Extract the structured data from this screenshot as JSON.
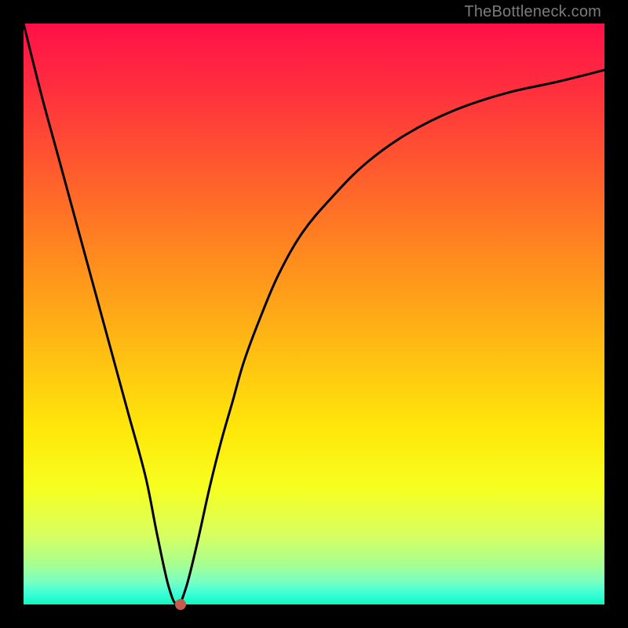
{
  "watermark": "TheBottleneck.com",
  "chart_data": {
    "type": "line",
    "title": "",
    "xlabel": "",
    "ylabel": "",
    "xlim": [
      0,
      100
    ],
    "ylim": [
      0,
      100
    ],
    "background_gradient": {
      "top": "#ff1048",
      "bottom": "#10f7c0",
      "meaning": "red = high bottleneck, green = low bottleneck"
    },
    "series": [
      {
        "name": "bottleneck-curve",
        "x": [
          0,
          3,
          6,
          9,
          12,
          15,
          18,
          21,
          23,
          25,
          26.5,
          28,
          30,
          32,
          34,
          36,
          38,
          41,
          44,
          48,
          53,
          59,
          66,
          74,
          83,
          92,
          100
        ],
        "y": [
          100,
          88,
          77,
          66,
          55,
          44,
          33,
          22,
          12,
          3,
          0,
          3,
          11,
          20,
          28,
          35,
          42,
          50,
          57,
          64,
          70,
          76,
          81,
          85,
          88,
          90,
          92
        ]
      }
    ],
    "marker": {
      "x": 27,
      "y": 0,
      "color": "#c65a4e"
    },
    "grid": false,
    "legend": false
  }
}
